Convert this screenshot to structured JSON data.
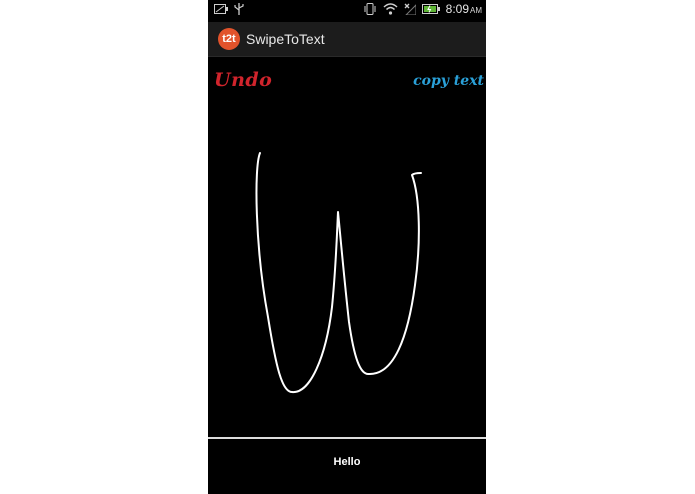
{
  "status_bar": {
    "time": "8:09",
    "ampm": "AM",
    "icons": [
      "battery-saver-icon",
      "usb-icon",
      "vibrate-icon",
      "wifi-icon",
      "no-signal-icon",
      "battery-charging-icon"
    ]
  },
  "action_bar": {
    "app_icon_text": "t2t",
    "title": "SwipeToText"
  },
  "canvas": {
    "undo_label": "Undo",
    "copy_label": "copy text",
    "stroke_color": "#ffffff",
    "background": "#000000"
  },
  "result": {
    "text": "Hello"
  },
  "colors": {
    "undo": "#d1242c",
    "copy": "#2aa0d8",
    "app_icon": "#e2532b"
  }
}
